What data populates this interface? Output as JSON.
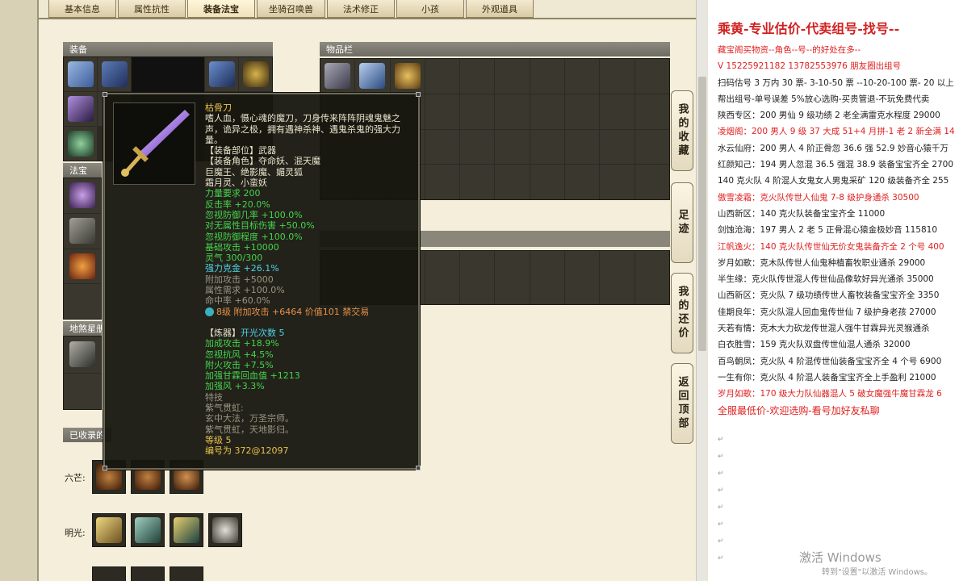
{
  "tabs": [
    {
      "label": "基本信息",
      "active": false
    },
    {
      "label": "属性抗性",
      "active": false
    },
    {
      "label": "装备法宝",
      "active": true
    },
    {
      "label": "坐骑召唤兽",
      "active": false
    },
    {
      "label": "法术修正",
      "active": false
    },
    {
      "label": "小孩",
      "active": false
    },
    {
      "label": "外观道具",
      "active": false
    }
  ],
  "panels": {
    "equipment": "装备",
    "inventory": "物品栏",
    "treasure": "法宝",
    "dungeon": "地煞星册",
    "collected": "已收录的"
  },
  "rows": {
    "liumang": "六芒:",
    "mingguang": "明光:"
  },
  "side_buttons": [
    "我的收藏",
    "足迹",
    "我的还价",
    "返回顶部"
  ],
  "tooltip": {
    "name": "枯骨刀",
    "description": "嗜人血，慑心魂的魔刀，刀身传来阵阵阴魂鬼魅之声，诡异之极，拥有遇神杀神、遇鬼杀鬼的强大力量。",
    "slot": "【装备部位】武器",
    "roles_line1": "【装备角色】夺命妖、混天魔",
    "roles_line2": "巨魔王、绝影魔、媚灵狐",
    "roles_line3": "霜月灵、小蛮妖",
    "stats_white": [
      "力量要求 200",
      "反击率 +20.0%",
      "忽视防御几率 +100.0%",
      "对无属性目标伤害 +50.0%",
      "忽视防御程度 +100.0%",
      "基础攻击 +10000",
      "灵气 300/300"
    ],
    "stat_cyan": "强力克金 +26.1%",
    "stats_gray": [
      "附加攻击 +5000",
      "属性需求 +100.0%",
      "命中率 +60.0%"
    ],
    "gem_line": "8级 附加攻击 +6464 价值101 禁交易",
    "refine_header": "【炼器】",
    "refine_count": "开光次数 5",
    "refine_stats": [
      "加成攻击 +18.9%",
      "忽视抗风 +4.5%",
      "附火攻击 +7.5%",
      "加强甘霖回血值 +1213",
      "加强风 +3.3%"
    ],
    "skill_header": "特技",
    "skills": [
      "紫气贯虹:",
      "玄中大法，万圣宗师。",
      "紫气贯虹，天地影归。"
    ],
    "level": "等级 5",
    "serial": "编号为 372@12097"
  },
  "doc": {
    "header": "乘黄-专业估价-代卖组号-找号--",
    "lines": [
      {
        "text": "藏宝阁买物资--角色--号--的好处在多--",
        "style": "red"
      },
      {
        "text": "V 15225921182    13782553976  朋友圈出组号",
        "style": "red"
      },
      {
        "text": "扫码估号 3 万内 30 票- 3-10-50 票  --10-20-100 票- 20 以上",
        "style": ""
      },
      {
        "text": "帮出组号-单号误差 5%放心选购-买贵管退-不玩免费代卖",
        "style": ""
      },
      {
        "text": "陕西专区：200 男仙 9 级功绩 2 老全满雷克水程度 29000",
        "style": ""
      },
      {
        "text": "凌烟阁：200 男人 9 级 37 大成 51+4 月拼-1 老 2 新全满 14",
        "style": "red"
      },
      {
        "text": "水云仙府：200 男人 4 阶正骨忽 36.6 强 52.9 妙音心猿千万",
        "style": ""
      },
      {
        "text": "红颜知己：194 男人忽混 36.5 强混 38.9 装备宝宝齐全 2700",
        "style": ""
      },
      {
        "text": "140 克火队 4 阶混人女鬼女人男鬼采矿 120 级装备齐全 255",
        "style": ""
      },
      {
        "text": "傲雪凌霜：克火队传世人仙鬼 7-8 级护身通杀 30500",
        "style": "red"
      },
      {
        "text": "山西新区：140 克火队装备宝宝齐全 11000",
        "style": ""
      },
      {
        "text": "剑蚀沧海：197 男人 2 老 5 正骨混心猿金极妙音 115810",
        "style": ""
      },
      {
        "text": "江帆逸火：140 克火队传世仙无价女鬼装备齐全 2 个号 400",
        "style": "red"
      },
      {
        "text": "岁月如歌：克木队传世人仙鬼种植畜牧职业通杀 29000",
        "style": ""
      },
      {
        "text": "半生缘：克火队传世混人传世仙品像软好异光通杀 35000",
        "style": ""
      },
      {
        "text": "山西新区：克火队 7 级功绩传世人畜牧装备宝宝齐全 3350",
        "style": ""
      },
      {
        "text": "佳期良年：克火队混人回血鬼传世仙 7 级护身老孩 27000",
        "style": ""
      },
      {
        "text": "天若有情：克木大力砍龙传世混人强牛甘霖异光灵猴通杀",
        "style": ""
      },
      {
        "text": "白衣胜雪：159 克火队双盘传世仙混人通杀 32000",
        "style": ""
      },
      {
        "text": "百鸟朝凤：克火队 4 阶混传世仙装备宝宝齐全 4 个号 6900",
        "style": ""
      },
      {
        "text": "一生有你：克火队 4 阶混人装备宝宝齐全上手盈利 21000",
        "style": ""
      },
      {
        "text": "岁月如歌：170 级大力队仙器混人 5 破女魔强牛魔甘霖龙 6",
        "style": "red"
      },
      {
        "text": "全服最低价-欢迎选购-看号加好友私聊",
        "style": "bigred"
      }
    ]
  },
  "watermark": {
    "title": "激活 Windows",
    "subtitle": "转到\"设置\"以激活 Windows。"
  },
  "colors": {
    "tooltip_bg": "#16160f",
    "name_gold": "#e9c04a",
    "stat_green": "#46d44c",
    "stat_cyan": "#4fd2e6",
    "doc_red": "#d02020"
  }
}
